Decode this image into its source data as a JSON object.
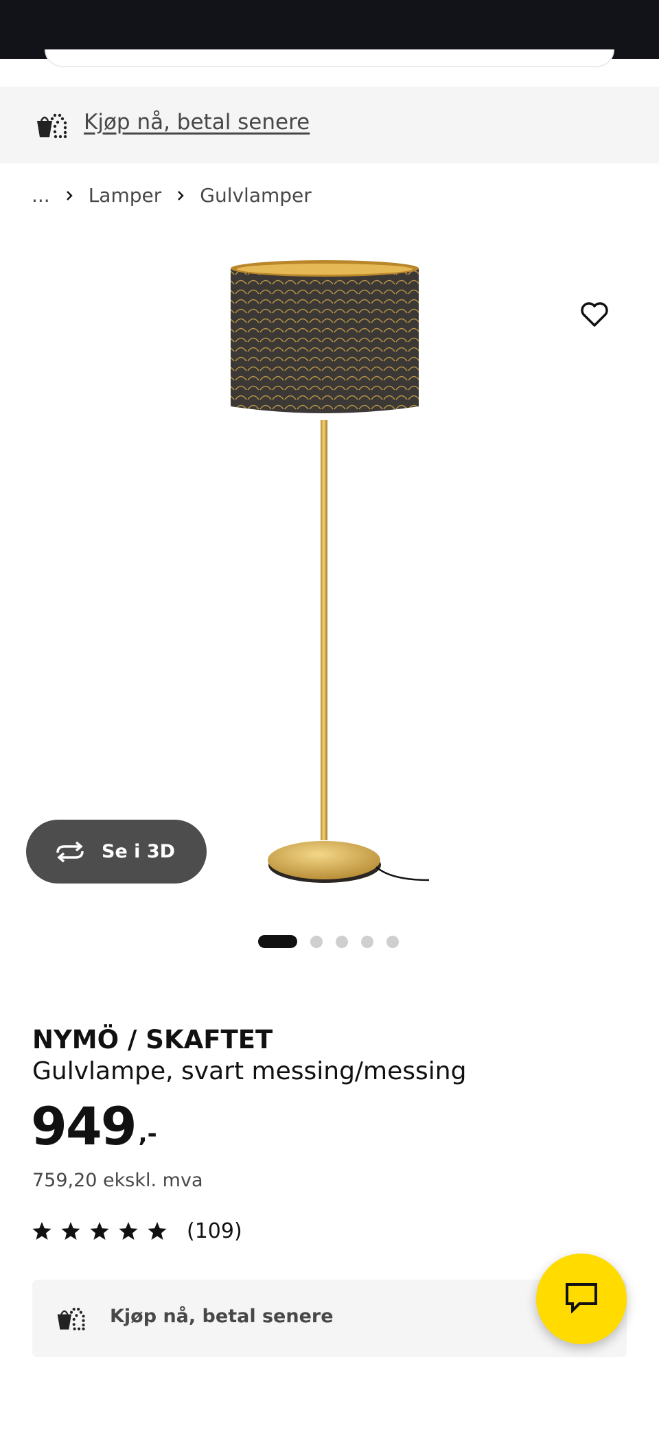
{
  "payment_banner": {
    "link_text": "Kjøp nå, betal senere",
    "icon": "bag-with-coins-icon"
  },
  "breadcrumb": {
    "ellipsis": "...",
    "items": [
      "Lamper",
      "Gulvlamper"
    ]
  },
  "gallery": {
    "view_3d_label": "Se i 3D",
    "slide_count": 5,
    "active_slide": 1
  },
  "product": {
    "name": "NYMÖ / SKAFTET",
    "description": "Gulvlampe, svart messing/messing",
    "price": "949",
    "price_suffix": ",-",
    "price_ex_vat": "759,20 ekskl. mva",
    "rating": 5,
    "review_count": "(109)"
  },
  "payment_card": {
    "label": "Kjøp nå, betal senere"
  },
  "colors": {
    "brand_yellow": "#ffdb00",
    "text_dark": "#111111",
    "text_grey": "#484848",
    "banner_bg": "#f5f5f5"
  }
}
